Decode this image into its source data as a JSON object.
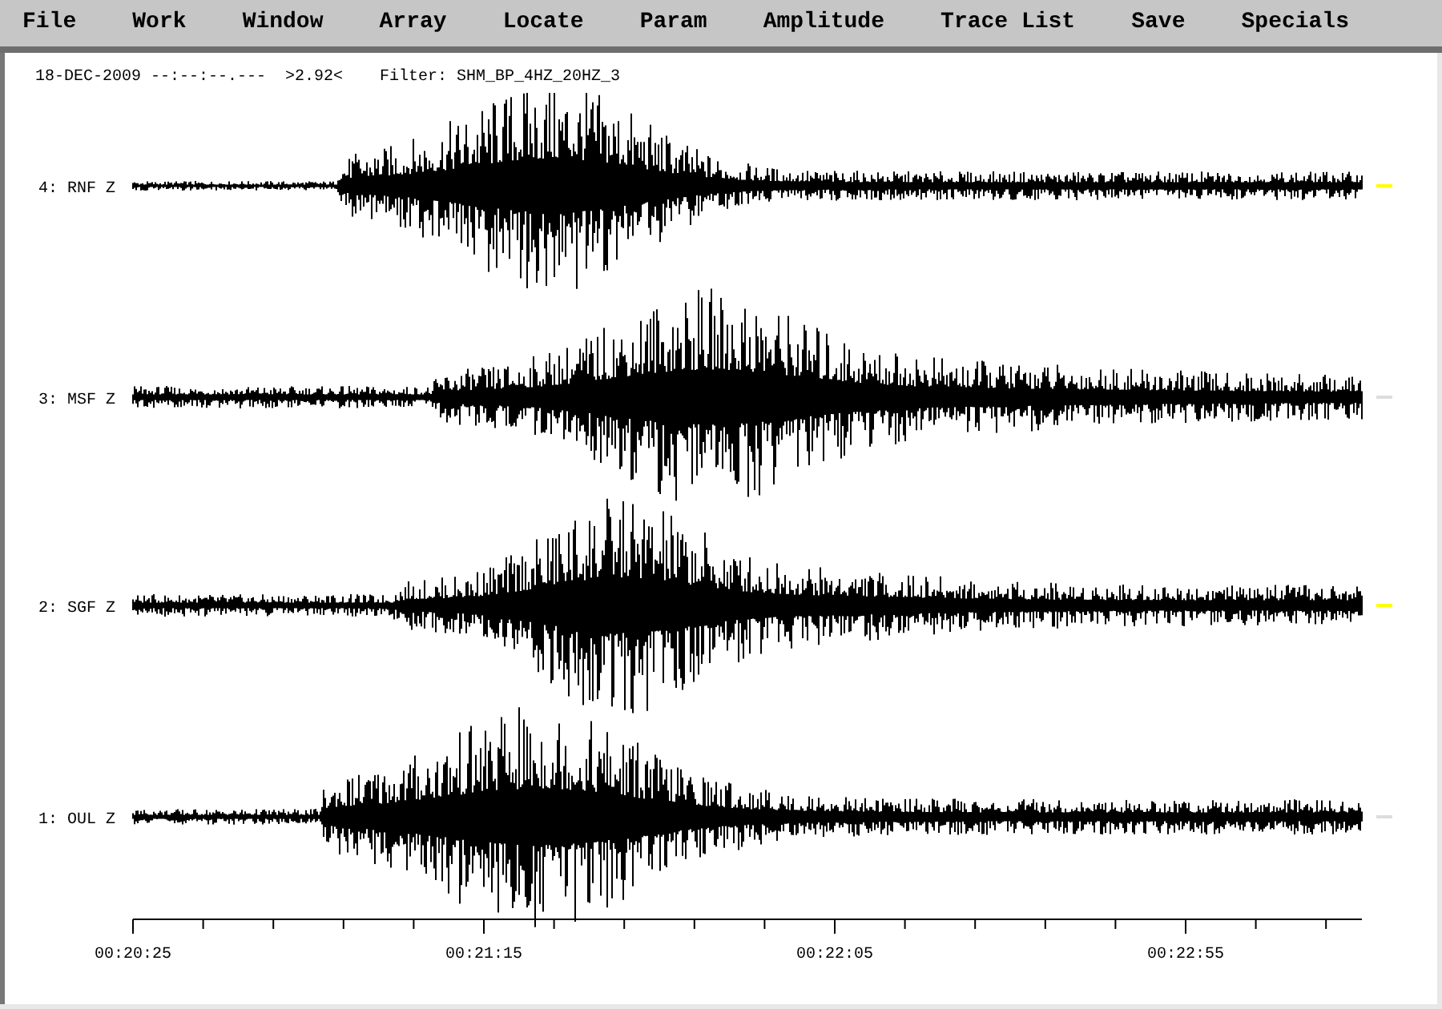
{
  "menu": [
    "File",
    "Work",
    "Window",
    "Array",
    "Locate",
    "Param",
    "Amplitude",
    "Trace List",
    "Save",
    "Specials"
  ],
  "header": {
    "date_time": "18-DEC-2009 --:--:--.---",
    "scale": ">2.92<",
    "filter": "Filter: SHM_BP_4HZ_20HZ_3"
  },
  "traces": [
    {
      "label": "4: RNF Z",
      "marked": true
    },
    {
      "label": "3: MSF Z",
      "marked": false
    },
    {
      "label": "2: SGF Z",
      "marked": true
    },
    {
      "label": "1: OUL Z",
      "marked": false
    }
  ],
  "time_axis": {
    "labels": [
      "00:20:25",
      "00:21:15",
      "00:22:05",
      "00:22:55"
    ]
  }
}
